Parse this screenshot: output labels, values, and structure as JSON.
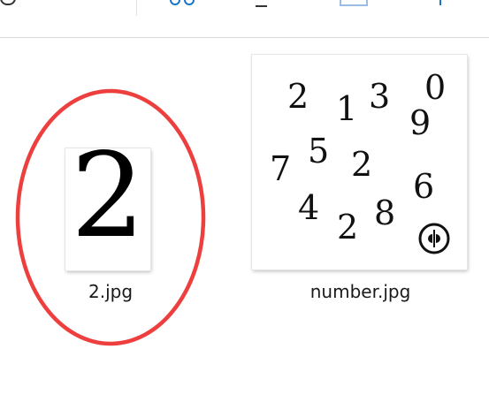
{
  "files": [
    {
      "name": "2.jpg",
      "thumbnail_text": "2"
    },
    {
      "name": "number.jpg",
      "thumbnail_digits": [
        "2",
        "1",
        "3",
        "0",
        "9",
        "7",
        "5",
        "2",
        "6",
        "4",
        "2",
        "8"
      ],
      "thumbnail_logo": "watermark-logo"
    }
  ],
  "toolbar": {
    "icons": [
      "toolbar-icon-partial-1",
      "toolbar-icon-partial-2",
      "toolbar-icon-partial-3",
      "toolbar-icon-partial-4",
      "toolbar-icon-partial-5"
    ]
  },
  "annotation": {
    "shape": "ellipse",
    "color": "#ee3f3f"
  }
}
